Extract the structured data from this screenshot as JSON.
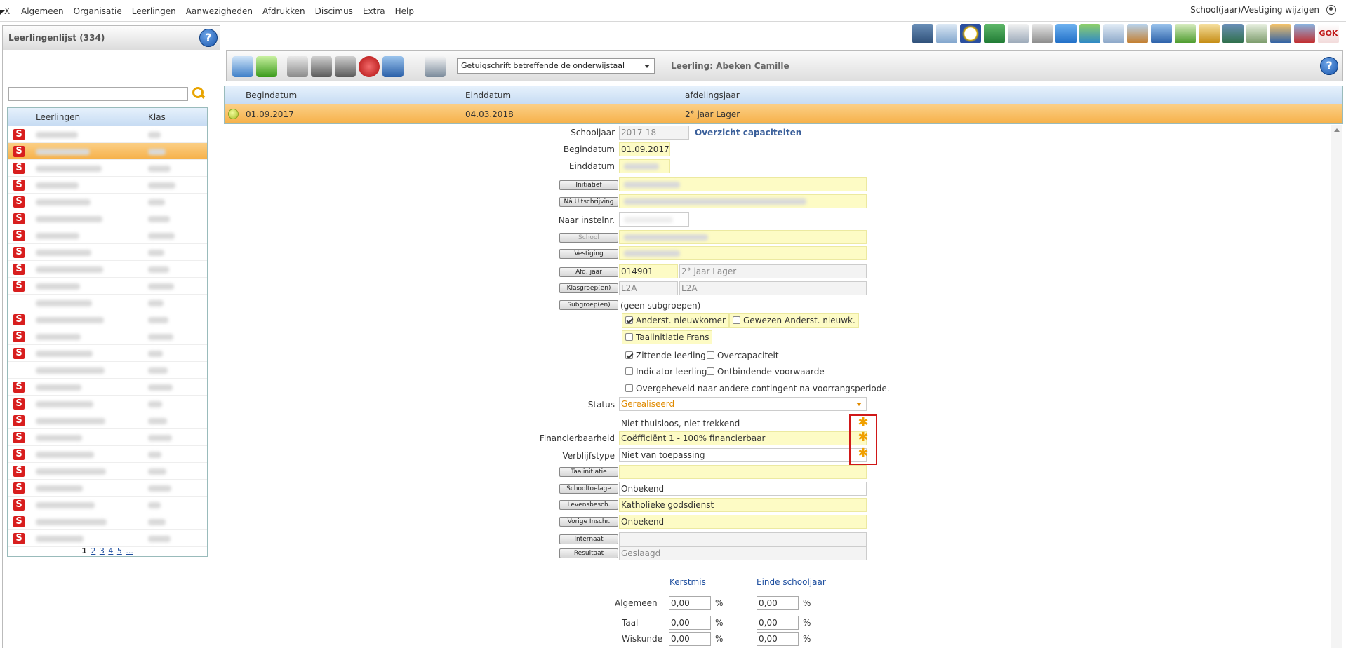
{
  "menu": {
    "x": "X",
    "items": [
      "Algemeen",
      "Organisatie",
      "Leerlingen",
      "Aanwezigheden",
      "Afdrukken",
      "Discimus",
      "Extra",
      "Help"
    ],
    "right": "School(jaar)/Vestiging wijzigen"
  },
  "left": {
    "title": "Leerlingenlijst (334)",
    "help": "?",
    "col_students": "Leerlingen",
    "col_class": "Klas",
    "row_icon": "S",
    "pager_current": "1",
    "pager_pages": [
      "2",
      "3",
      "4",
      "5",
      "..."
    ]
  },
  "toolbar": {
    "document_select": "Getuigschrift betreffende de onderwijstaal",
    "student": "Leerling: Abeken Camille",
    "help": "?"
  },
  "periods": {
    "headers": [
      "Begindatum",
      "Einddatum",
      "afdelingsjaar"
    ],
    "rows": [
      {
        "begin": "01.09.2017",
        "end": "04.03.2018",
        "year": "2° jaar Lager"
      }
    ]
  },
  "form": {
    "schooljaar_label": "Schooljaar",
    "schooljaar": "2017-18",
    "overzicht": "Overzicht capaciteiten",
    "begindatum_label": "Begindatum",
    "begindatum": "01.09.2017",
    "einddatum_label": "Einddatum",
    "initiatief_btn": "Initiatief",
    "na_uitschrijving_btn": "Nâ Uitschrijving",
    "naar_instelnr_label": "Naar instelnr.",
    "school_btn": "School",
    "vestiging_btn": "Vestiging",
    "afd_jaar_btn": "Afd. jaar",
    "afd_jaar_code": "014901",
    "afd_jaar_name": "2° jaar Lager",
    "klasgroep_btn": "Klasgroep(en)",
    "klasgroep_a": "L2A",
    "klasgroep_b": "L2A",
    "subgroep_btn": "Subgroep(en)",
    "subgroep": "(geen subgroepen)",
    "cb_anderst": "Anderst. nieuwkomer",
    "cb_gewezen": "Gewezen Anderst. nieuwk.",
    "cb_taalinitiatie": "Taalinitiatie Frans",
    "cb_zittende": "Zittende leerling",
    "cb_overcap": "Overcapaciteit",
    "cb_indicator": "Indicator-leerling",
    "cb_ontbindende": "Ontbindende voorwaarde",
    "cb_overgeheveld": "Overgeheveld naar andere contingent na voorrangsperiode.",
    "status_label": "Status",
    "status": "Gerealiseerd",
    "thuisloos": "Niet thuisloos, niet trekkend",
    "financierbaarheid_label": "Financierbaarheid",
    "financierbaarheid": "Coëfficiënt 1 - 100% financierbaar",
    "verblijfstype_label": "Verblijfstype",
    "verblijfstype": "Niet van toepassing",
    "taalinitiatie_btn": "Taalinitiatie",
    "schooltoelage_btn": "Schooltoelage",
    "schooltoelage": "Onbekend",
    "levensbesch_btn": "Levensbesch.",
    "levensbesch": "Katholieke godsdienst",
    "vorige_inschr_btn": "Vorige Inschr.",
    "vorige_inschr": "Onbekend",
    "internaat_btn": "Internaat",
    "resultaat_btn": "Resultaat",
    "resultaat": "Geslaagd",
    "kerstmis": "Kerstmis",
    "einde_schooljaar": "Einde schooljaar",
    "scores": [
      {
        "label": "Algemeen",
        "k": "0,00",
        "e": "0,00"
      },
      {
        "label": "Taal",
        "k": "0,00",
        "e": "0,00"
      },
      {
        "label": "Wiskunde",
        "k": "0,00",
        "e": "0,00"
      }
    ],
    "pct": "%",
    "star": "✱"
  }
}
